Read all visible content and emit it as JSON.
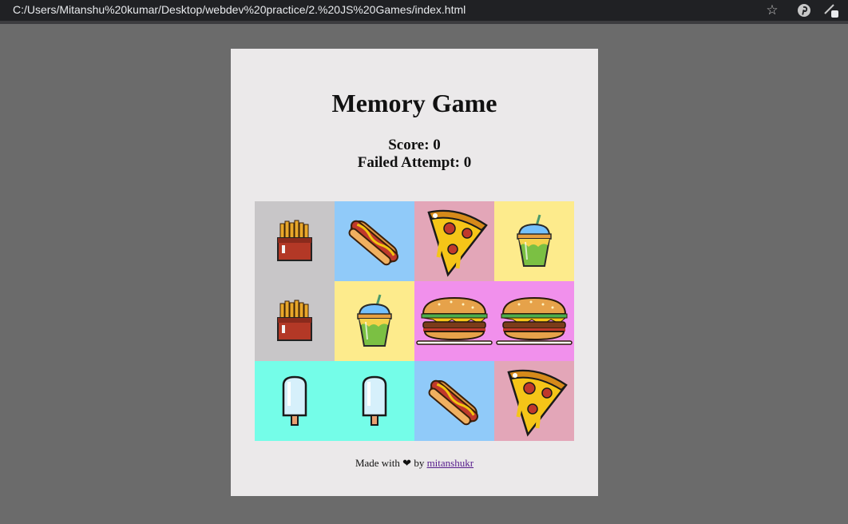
{
  "browser": {
    "url": "C:/Users/Mitanshu%20kumar/Desktop/webdev%20practice/2.%20JS%20Games/index.html",
    "icons": [
      "star-icon",
      "pinterest-icon",
      "extension-icon"
    ]
  },
  "game": {
    "title": "Memory Game",
    "score_text": "Score: 0",
    "failed_text": "Failed Attempt: 0"
  },
  "grid": {
    "tiles": [
      {
        "item": "fries",
        "bg": "#c8c6c8"
      },
      {
        "item": "hotdog",
        "bg": "#90caf9"
      },
      {
        "item": "pizza",
        "bg": "#e3a6b8"
      },
      {
        "item": "milkshake",
        "bg": "#fdeb8c"
      },
      {
        "item": "fries",
        "bg": "#c8c6c8"
      },
      {
        "item": "milkshake",
        "bg": "#fdeb8c"
      },
      {
        "item": "burger",
        "bg": "#f190ec"
      },
      {
        "item": "burger",
        "bg": "#f190ec"
      },
      {
        "item": "icecream",
        "bg": "#74fde8"
      },
      {
        "item": "icecream",
        "bg": "#74fde8"
      },
      {
        "item": "hotdog",
        "bg": "#90caf9"
      },
      {
        "item": "pizza",
        "bg": "#e3a6b8"
      }
    ]
  },
  "footer": {
    "made_with": "Made with",
    "by": "by",
    "author": "mitanshukr"
  }
}
